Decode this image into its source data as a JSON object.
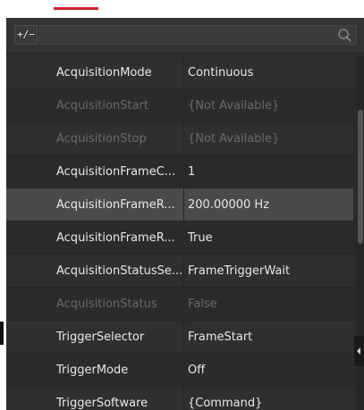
{
  "toolbar": {
    "expand_collapse_label": "+/−",
    "search_placeholder": "",
    "search_icon": "search-icon"
  },
  "parameters": [
    {
      "name": "AcquisitionMode",
      "value": "Continuous",
      "state": "enabled"
    },
    {
      "name": "AcquisitionStart",
      "value": "{Not Available}",
      "state": "disabled"
    },
    {
      "name": "AcquisitionStop",
      "value": "{Not Available}",
      "state": "disabled"
    },
    {
      "name": "AcquisitionFrameC...",
      "value": "1",
      "state": "enabled"
    },
    {
      "name": "AcquisitionFrameR...",
      "value": "200.00000 Hz",
      "state": "selected"
    },
    {
      "name": "AcquisitionFrameR...",
      "value": "True",
      "state": "enabled"
    },
    {
      "name": "AcquisitionStatusSe...",
      "value": "FrameTriggerWait",
      "state": "enabled"
    },
    {
      "name": "AcquisitionStatus",
      "value": "False",
      "state": "disabled"
    },
    {
      "name": "TriggerSelector",
      "value": "FrameStart",
      "state": "enabled"
    },
    {
      "name": "TriggerMode",
      "value": "Off",
      "state": "enabled"
    },
    {
      "name": "TriggerSoftware",
      "value": "{Command}",
      "state": "enabled"
    }
  ],
  "colors": {
    "panel_bg": "#2b2b2b",
    "row_selected": "#4a4a4a",
    "text": "#e8e8e8",
    "text_disabled": "#6a6a6a",
    "caption_underline": "#d0202a"
  }
}
